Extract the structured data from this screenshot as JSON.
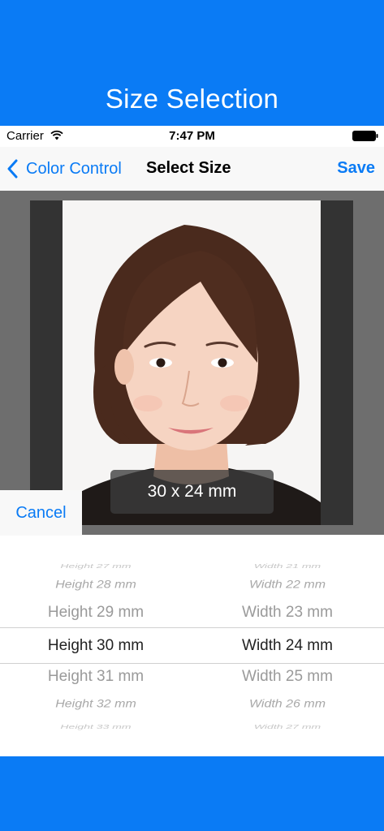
{
  "banner": {
    "title": "Size Selection"
  },
  "status_bar": {
    "carrier": "Carrier",
    "time": "7:47 PM"
  },
  "nav": {
    "back_label": "Color Control",
    "title": "Select Size",
    "save_label": "Save"
  },
  "photo": {
    "size_label": "30 x 24 mm"
  },
  "cancel_label": "Cancel",
  "picker": {
    "heights": [
      "Height 27 mm",
      "Height 28 mm",
      "Height 29 mm",
      "Height 30 mm",
      "Height 31 mm",
      "Height 32 mm",
      "Height 33 mm"
    ],
    "widths": [
      "Width 21 mm",
      "Width 22 mm",
      "Width 23 mm",
      "Width 24 mm",
      "Width 25 mm",
      "Width 26 mm",
      "Width 27 mm"
    ],
    "selected_height": "Height 30 mm",
    "selected_width": "Width 24 mm"
  },
  "colors": {
    "accent": "#0a7bf5",
    "banner": "#0a7bf5",
    "editor_bg": "#6e6e6e",
    "frame_bg": "#333333"
  },
  "icons": {
    "back": "chevron-left-icon",
    "wifi": "wifi-icon",
    "battery": "battery-icon"
  }
}
